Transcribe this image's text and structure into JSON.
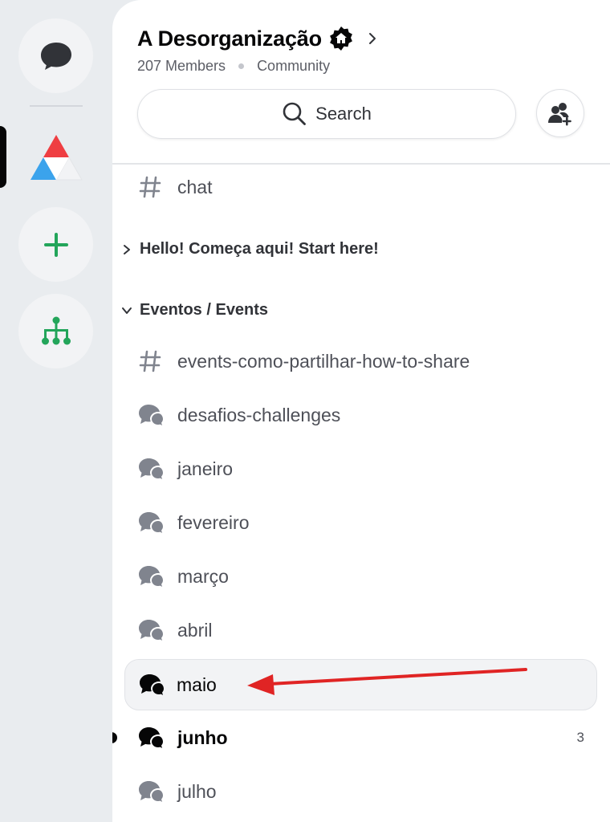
{
  "server": {
    "name": "A Desorganização",
    "members": "207 Members",
    "type": "Community"
  },
  "search": {
    "label": "Search"
  },
  "channels": {
    "top": [
      {
        "name": "chat",
        "icon": "hashtag-icon"
      }
    ],
    "categories": [
      {
        "label": "Hello! Começa aqui! Start here!",
        "collapsed": true
      },
      {
        "label": "Eventos / Events",
        "collapsed": false
      }
    ],
    "events": [
      {
        "name": "events-como-partilhar-how-to-share",
        "icon": "hashtag-icon"
      },
      {
        "name": "desafios-challenges",
        "icon": "forum-icon"
      },
      {
        "name": "janeiro",
        "icon": "forum-icon"
      },
      {
        "name": "fevereiro",
        "icon": "forum-icon"
      },
      {
        "name": "março",
        "icon": "forum-icon"
      },
      {
        "name": "abril",
        "icon": "forum-icon"
      },
      {
        "name": "maio",
        "icon": "forum-icon",
        "selected": true
      },
      {
        "name": "junho",
        "icon": "forum-icon",
        "unread": true,
        "badge": "3"
      },
      {
        "name": "julho",
        "icon": "forum-icon"
      }
    ]
  },
  "colors": {
    "accent_green": "#23a55a",
    "annotation_arrow": "#e02424",
    "logo_red": "#ef3e42",
    "logo_blue": "#3ba3ec"
  }
}
